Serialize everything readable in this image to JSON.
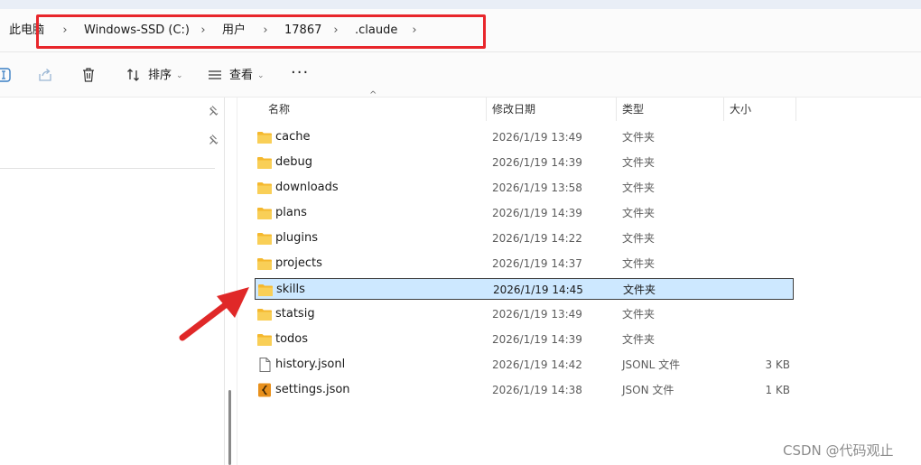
{
  "breadcrumb": {
    "items": [
      "此电脑",
      "Windows-SSD (C:)",
      "用户",
      "17867",
      ".claude"
    ],
    "separator": "›"
  },
  "toolbar": {
    "sort_label": "排序",
    "view_label": "查看",
    "more_label": "···"
  },
  "columns": {
    "name": "名称",
    "modified": "修改日期",
    "type": "类型",
    "size": "大小"
  },
  "files": [
    {
      "name": "cache",
      "modified": "2026/1/19 13:49",
      "type": "文件夹",
      "size": "",
      "icon": "folder-icon"
    },
    {
      "name": "debug",
      "modified": "2026/1/19 14:39",
      "type": "文件夹",
      "size": "",
      "icon": "folder-icon"
    },
    {
      "name": "downloads",
      "modified": "2026/1/19 13:58",
      "type": "文件夹",
      "size": "",
      "icon": "folder-icon"
    },
    {
      "name": "plans",
      "modified": "2026/1/19 14:39",
      "type": "文件夹",
      "size": "",
      "icon": "folder-icon"
    },
    {
      "name": "plugins",
      "modified": "2026/1/19 14:22",
      "type": "文件夹",
      "size": "",
      "icon": "folder-icon"
    },
    {
      "name": "projects",
      "modified": "2026/1/19 14:37",
      "type": "文件夹",
      "size": "",
      "icon": "folder-icon"
    },
    {
      "name": "skills",
      "modified": "2026/1/19 14:45",
      "type": "文件夹",
      "size": "",
      "icon": "folder-icon",
      "selected": true
    },
    {
      "name": "statsig",
      "modified": "2026/1/19 13:49",
      "type": "文件夹",
      "size": "",
      "icon": "folder-icon"
    },
    {
      "name": "todos",
      "modified": "2026/1/19 14:39",
      "type": "文件夹",
      "size": "",
      "icon": "folder-icon"
    },
    {
      "name": "history.jsonl",
      "modified": "2026/1/19 14:42",
      "type": "JSONL 文件",
      "size": "3 KB",
      "icon": "file-icon"
    },
    {
      "name": "settings.json",
      "modified": "2026/1/19 14:38",
      "type": "JSON 文件",
      "size": "1 KB",
      "icon": "json-file-icon"
    }
  ],
  "colors": {
    "highlight_box": "#e8262b",
    "annotation_arrow": "#e02828",
    "selection": "#cde8ff",
    "folder": "#f7c744"
  },
  "watermark": "CSDN @代码观止"
}
